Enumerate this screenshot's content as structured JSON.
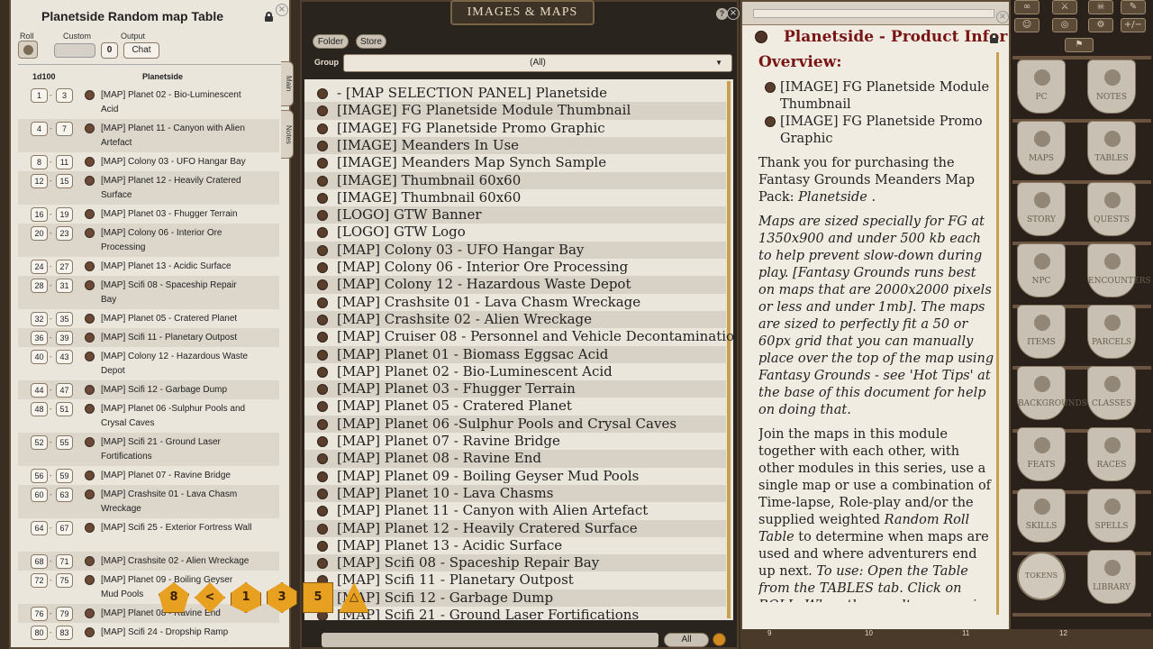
{
  "table_window": {
    "title": "Planetside Random map Table",
    "roll_label": "Roll",
    "custom_label": "Custom",
    "custom_value": "0",
    "output_label": "Output",
    "output_value": "Chat",
    "col_dice": "1d100",
    "col_result": "Planetside",
    "tab_main": "Main",
    "tab_notes": "Notes",
    "rows": [
      {
        "from": "1",
        "to": "3",
        "text": "[MAP] Planet 02 - Bio-Luminescent Acid"
      },
      {
        "from": "4",
        "to": "7",
        "text": "[MAP] Planet 11 - Canyon with Alien Artefact"
      },
      {
        "from": "8",
        "to": "11",
        "text": "[MAP] Colony 03 - UFO Hangar Bay"
      },
      {
        "from": "12",
        "to": "15",
        "text": "[MAP] Planet 12 - Heavily Cratered Surface"
      },
      {
        "from": "16",
        "to": "19",
        "text": "[MAP] Planet 03 - Fhugger Terrain"
      },
      {
        "from": "20",
        "to": "23",
        "text": "[MAP] Colony 06 - Interior Ore Processing"
      },
      {
        "from": "24",
        "to": "27",
        "text": "[MAP] Planet 13 - Acidic Surface"
      },
      {
        "from": "28",
        "to": "31",
        "text": "[MAP] Scifi 08 - Spaceship Repair Bay"
      },
      {
        "from": "32",
        "to": "35",
        "text": "[MAP] Planet 05 - Cratered Planet"
      },
      {
        "from": "36",
        "to": "39",
        "text": "[MAP] Scifi 11 - Planetary Outpost"
      },
      {
        "from": "40",
        "to": "43",
        "text": "[MAP] Colony 12 - Hazardous Waste Depot"
      },
      {
        "from": "44",
        "to": "47",
        "text": "[MAP] Scifi 12 - Garbage Dump"
      },
      {
        "from": "48",
        "to": "51",
        "text": "[MAP] Planet 06 -Sulphur Pools and Crysal Caves"
      },
      {
        "from": "52",
        "to": "55",
        "text": "[MAP] Scifi 21 - Ground Laser Fortifications"
      },
      {
        "from": "56",
        "to": "59",
        "text": "[MAP] Planet 07 - Ravine Bridge"
      },
      {
        "from": "60",
        "to": "63",
        "text": "[MAP] Crashsite 01 - Lava Chasm Wreckage"
      },
      {
        "from": "64",
        "to": "67",
        "text": "[MAP] Scifi 25 - Exterior Fortress Wall"
      },
      {
        "from": "68",
        "to": "71",
        "text": "[MAP] Crashsite 02 - Alien Wreckage"
      },
      {
        "from": "72",
        "to": "75",
        "text": "[MAP] Planet 09 - Boiling Geyser Mud Pools"
      },
      {
        "from": "76",
        "to": "79",
        "text": "[MAP] Planet 08 - Ravine End"
      },
      {
        "from": "80",
        "to": "83",
        "text": "[MAP] Scifi 24 - Dropship Ramp"
      }
    ]
  },
  "images_window": {
    "title": "IMAGES & MAPS",
    "folder_btn": "Folder",
    "store_btn": "Store",
    "group_label": "Group",
    "group_value": "(All)",
    "all_btn": "All",
    "items": [
      "- [MAP SELECTION PANEL] Planetside",
      "[IMAGE] FG Planetside Module Thumbnail",
      "[IMAGE] FG Planetside Promo Graphic",
      "[IMAGE] Meanders In Use",
      "[IMAGE] Meanders Map Synch Sample",
      "[IMAGE] Thumbnail 60x60",
      "[IMAGE] Thumbnail 60x60",
      "[LOGO] GTW Banner",
      "[LOGO] GTW Logo",
      "[MAP] Colony 03 - UFO Hangar Bay",
      "[MAP] Colony 06 - Interior Ore Processing",
      "[MAP] Colony 12 - Hazardous Waste Depot",
      "[MAP] Crashsite 01 - Lava Chasm Wreckage",
      "[MAP] Crashsite 02 - Alien Wreckage",
      "[MAP] Cruiser 08 - Personnel and Vehicle Decontaminatio",
      "[MAP] Planet 01 - Biomass Eggsac Acid",
      "[MAP] Planet 02 - Bio-Luminescent Acid",
      "[MAP] Planet 03 - Fhugger Terrain",
      "[MAP] Planet 05 - Cratered Planet",
      "[MAP] Planet 06 -Sulphur Pools and Crysal Caves",
      "[MAP] Planet 07 - Ravine Bridge",
      "[MAP] Planet 08 - Ravine End",
      "[MAP] Planet 09 - Boiling Geyser Mud Pools",
      "[MAP] Planet 10 - Lava Chasms",
      "[MAP] Planet 11 - Canyon with Alien Artefact",
      "[MAP] Planet 12 - Heavily Cratered Surface",
      "[MAP] Planet 13 - Acidic Surface",
      "[MAP] Scifi 08 - Spaceship Repair Bay",
      "[MAP] Scifi 11 - Planetary Outpost",
      "[MAP] Scifi 12 - Garbage Dump",
      "[MAP] Scifi 21 - Ground Laser Fortifications"
    ]
  },
  "story_window": {
    "title": "Planetside - Product Infor",
    "overview_heading": "Overview:",
    "links": [
      "[IMAGE] FG Planetside Module Thumbnail",
      "[IMAGE] FG Planetside Promo Graphic"
    ],
    "p1": "Thank you for purchasing the Fantasy Grounds Meanders Map Pack: ",
    "p1_em": "Planetside",
    "p1_end": " .",
    "p2": "Maps are sized specially for FG at 1350x900 and under 500 kb each to help prevent slow-down during play. [Fantasy Grounds runs best on maps that are 2000x2000 pixels or less and under 1mb]. The maps are sized to perfectly fit a 50 or 60px grid that you can manually place over the top of the map using Fantasy Grounds - see 'Hot Tips' at the base of this document for help on doing that.",
    "p3a": "Join the maps in this module together with each other, with other modules in this series, use a single map or use a combination of Time-lapse, Role-play and/or the supplied weighted ",
    "p3_em": "Random Roll Table",
    "p3b": " to determine when maps are used and where adventurers end up next. ",
    "p3_em2": "To use: Open the Table from the TABLES tab. Click on ROLL. When the result appears in the Chat Window click the 'i' icon to bring up"
  },
  "sidebar": {
    "buttons": [
      "PC",
      "NOTES",
      "MAPS",
      "TABLES",
      "STORY",
      "QUESTS",
      "NPC",
      "ENCOUNTERS",
      "ITEMS",
      "PARCELS",
      "BACKGROUNDS",
      "CLASSES",
      "FEATS",
      "RACES",
      "SKILLS",
      "SPELLS",
      "TOKENS",
      "LIBRARY"
    ],
    "top_icons": [
      "∞",
      "⚔",
      "☠",
      "✎",
      "☺",
      "◎",
      "⚙",
      "+/−"
    ]
  },
  "dice": [
    "8",
    "<",
    "1",
    "3",
    "5",
    "△"
  ],
  "hotbar": [
    "9",
    "10",
    "11",
    "12"
  ]
}
